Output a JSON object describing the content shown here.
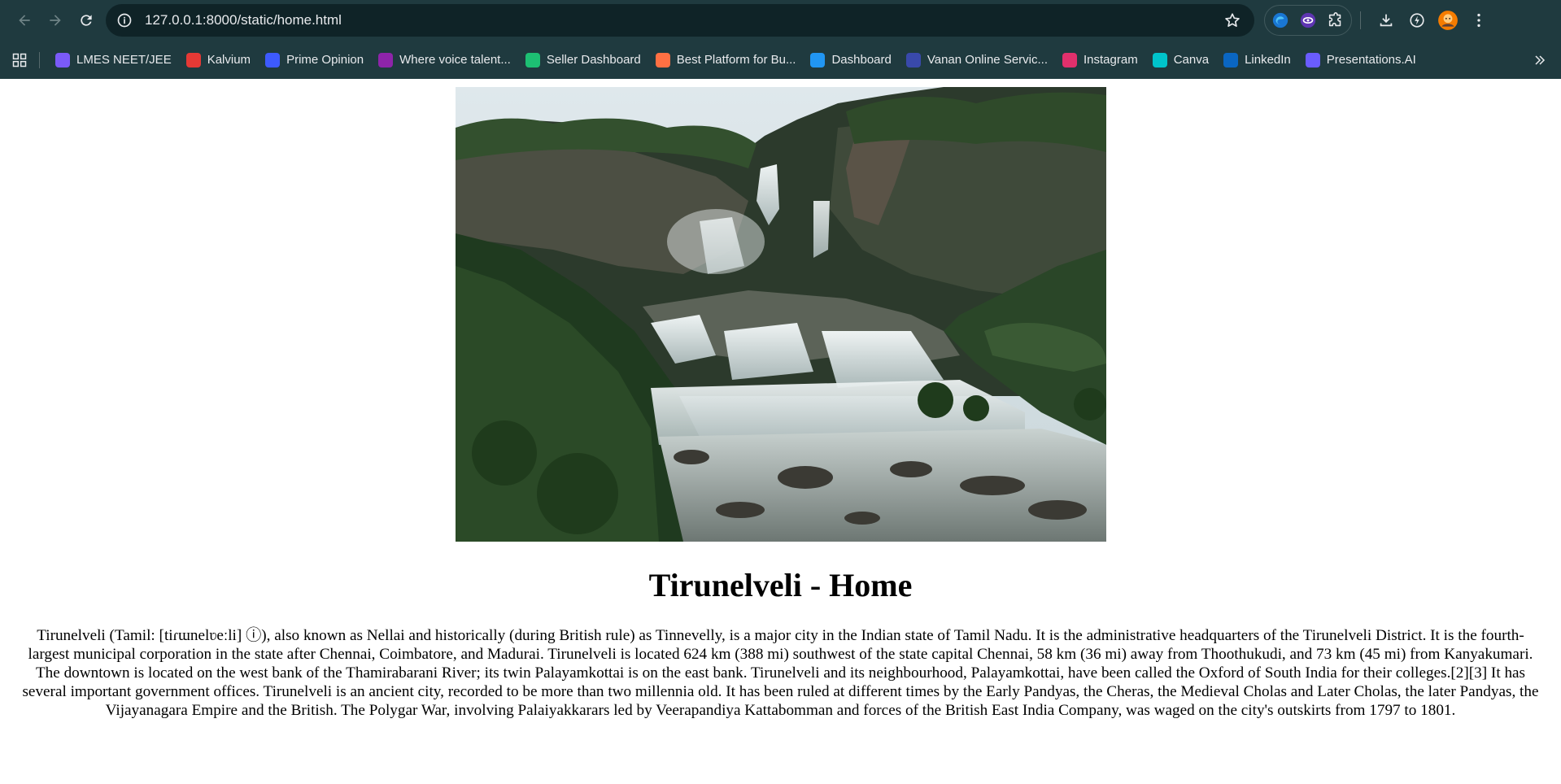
{
  "browser": {
    "url": "127.0.0.1:8000/static/home.html",
    "bookmarks": [
      {
        "label": "LMES NEET/JEE",
        "icon": "lmes-icon",
        "color": "#7a5af8"
      },
      {
        "label": "Kalvium",
        "icon": "kalvium-icon",
        "color": "#e53935"
      },
      {
        "label": "Prime Opinion",
        "icon": "prime-opinion-icon",
        "color": "#3d5afe"
      },
      {
        "label": "Where voice talent...",
        "icon": "voices-icon",
        "color": "#8e24aa"
      },
      {
        "label": "Seller Dashboard",
        "icon": "fiverr-icon",
        "color": "#1dbf73"
      },
      {
        "label": "Best Platform for Bu...",
        "icon": "platform-icon",
        "color": "#ff7043"
      },
      {
        "label": "Dashboard",
        "icon": "dashboard-icon",
        "color": "#2196f3"
      },
      {
        "label": "Vanan Online Servic...",
        "icon": "vanan-icon",
        "color": "#3949ab"
      },
      {
        "label": "Instagram",
        "icon": "instagram-icon",
        "color": "#e1306c"
      },
      {
        "label": "Canva",
        "icon": "canva-icon",
        "color": "#00c4cc"
      },
      {
        "label": "LinkedIn",
        "icon": "linkedin-icon",
        "color": "#0a66c2"
      },
      {
        "label": "Presentations.AI",
        "icon": "presentations-ai-icon",
        "color": "#6a5cff"
      }
    ]
  },
  "page": {
    "image_alt": "Waterfall",
    "title": "Tirunelveli - Home",
    "paragraph": "Tirunelveli (Tamil: [tiɾɯnelʋeːli] ⓘ), also known as Nellai and historically (during British rule) as Tinnevelly, is a major city in the Indian state of Tamil Nadu. It is the administrative headquarters of the Tirunelveli District. It is the fourth-largest municipal corporation in the state after Chennai, Coimbatore, and Madurai. Tirunelveli is located 624 km (388 mi) southwest of the state capital Chennai, 58 km (36 mi) away from Thoothukudi, and 73 km (45 mi) from Kanyakumari. The downtown is located on the west bank of the Thamirabarani River; its twin Palayamkottai is on the east bank. Tirunelveli and its neighbourhood, Palayamkottai, have been called the Oxford of South India for their colleges.[2][3] It has several important government offices. Tirunelveli is an ancient city, recorded to be more than two millennia old. It has been ruled at different times by the Early Pandyas, the Cheras, the Medieval Cholas and Later Cholas, the later Pandyas, the Vijayanagara Empire and the British. The Polygar War, involving Palaiyakkarars led by Veerapandiya Kattabomman and forces of the British East India Company, was waged on the city's outskirts from 1797 to 1801."
  }
}
